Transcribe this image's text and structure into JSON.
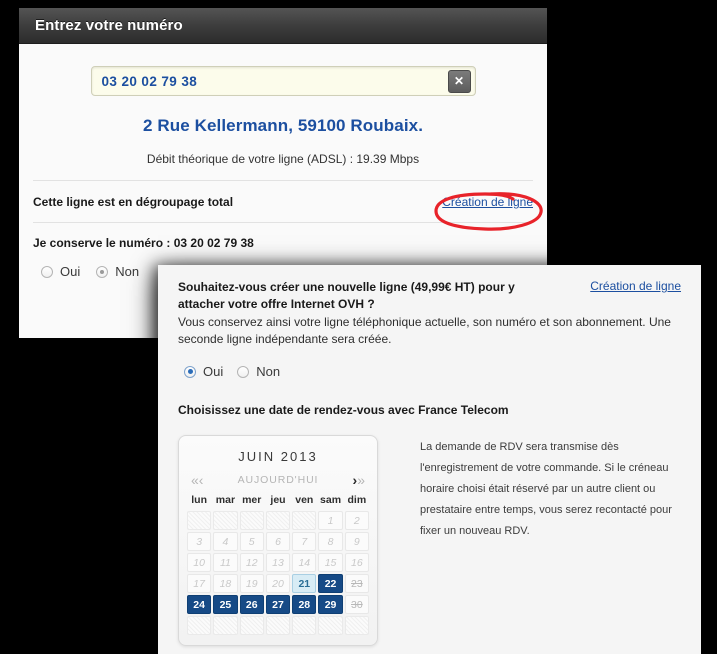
{
  "back_panel": {
    "header_title": "Entrez votre numéro",
    "search": {
      "value": "03 20 02 79 38",
      "clear_icon": "close-x-icon"
    },
    "address": "2 Rue Kellermann, 59100 Roubaix.",
    "speed": "Débit théorique de votre ligne (ADSL) : 19.39 Mbps",
    "degroupage_label": "Cette ligne est en dégroupage total",
    "creation_link": "Création de ligne",
    "keep_number": "Je conserve le numéro : 03 20 02 79 38",
    "radios": [
      {
        "label": "Oui",
        "selected": false
      },
      {
        "label": "Non",
        "selected": true
      }
    ]
  },
  "front_panel": {
    "question_title": "Souhaitez-vous créer une nouvelle ligne (49,99€ HT) pour y attacher votre offre Internet OVH ?",
    "creation_link": "Création de ligne",
    "question_desc": "Vous conservez ainsi votre ligne téléphonique actuelle, son numéro et son abonnement. Une seconde ligne indépendante sera créée.",
    "radios": [
      {
        "label": "Oui",
        "selected": true
      },
      {
        "label": "Non",
        "selected": false
      }
    ],
    "appointment_title": "Choisissez une date de rendez-vous avec France Telecom",
    "note": "La demande de RDV sera transmise dès l'enregistrement de votre commande. Si le créneau horaire choisi était réservé par un autre client ou prestataire entre temps, vous serez recontacté pour fixer un nouveau RDV.",
    "calendar": {
      "month_label": "JUIN 2013",
      "nav": {
        "prev_year": "«",
        "prev_month": "‹",
        "today": "AUJOURD'HUI",
        "next_month": "›",
        "next_year": "»"
      },
      "weekdays": [
        "lun",
        "mar",
        "mer",
        "jeu",
        "ven",
        "sam",
        "dim"
      ],
      "cells": [
        {
          "label": "",
          "state": "empty"
        },
        {
          "label": "",
          "state": "empty"
        },
        {
          "label": "",
          "state": "empty"
        },
        {
          "label": "",
          "state": "empty"
        },
        {
          "label": "",
          "state": "empty"
        },
        {
          "label": "1",
          "state": "disabled"
        },
        {
          "label": "2",
          "state": "disabled"
        },
        {
          "label": "3",
          "state": "disabled"
        },
        {
          "label": "4",
          "state": "disabled"
        },
        {
          "label": "5",
          "state": "disabled"
        },
        {
          "label": "6",
          "state": "disabled"
        },
        {
          "label": "7",
          "state": "disabled"
        },
        {
          "label": "8",
          "state": "disabled"
        },
        {
          "label": "9",
          "state": "disabled"
        },
        {
          "label": "10",
          "state": "disabled"
        },
        {
          "label": "11",
          "state": "disabled"
        },
        {
          "label": "12",
          "state": "disabled"
        },
        {
          "label": "13",
          "state": "disabled"
        },
        {
          "label": "14",
          "state": "disabled"
        },
        {
          "label": "15",
          "state": "disabled"
        },
        {
          "label": "16",
          "state": "disabled"
        },
        {
          "label": "17",
          "state": "disabled"
        },
        {
          "label": "18",
          "state": "disabled"
        },
        {
          "label": "19",
          "state": "disabled"
        },
        {
          "label": "20",
          "state": "disabled"
        },
        {
          "label": "21",
          "state": "today"
        },
        {
          "label": "22",
          "state": "avail"
        },
        {
          "label": "23",
          "state": "struck"
        },
        {
          "label": "24",
          "state": "avail"
        },
        {
          "label": "25",
          "state": "avail"
        },
        {
          "label": "26",
          "state": "avail"
        },
        {
          "label": "27",
          "state": "avail"
        },
        {
          "label": "28",
          "state": "avail"
        },
        {
          "label": "29",
          "state": "avail"
        },
        {
          "label": "30",
          "state": "struck"
        },
        {
          "label": "",
          "state": "empty"
        },
        {
          "label": "",
          "state": "empty"
        },
        {
          "label": "",
          "state": "empty"
        },
        {
          "label": "",
          "state": "empty"
        },
        {
          "label": "",
          "state": "empty"
        },
        {
          "label": "",
          "state": "empty"
        },
        {
          "label": "",
          "state": "empty"
        }
      ]
    }
  },
  "annotation": {
    "shape": "red-ellipse-highlight",
    "color": "#e8232a"
  }
}
